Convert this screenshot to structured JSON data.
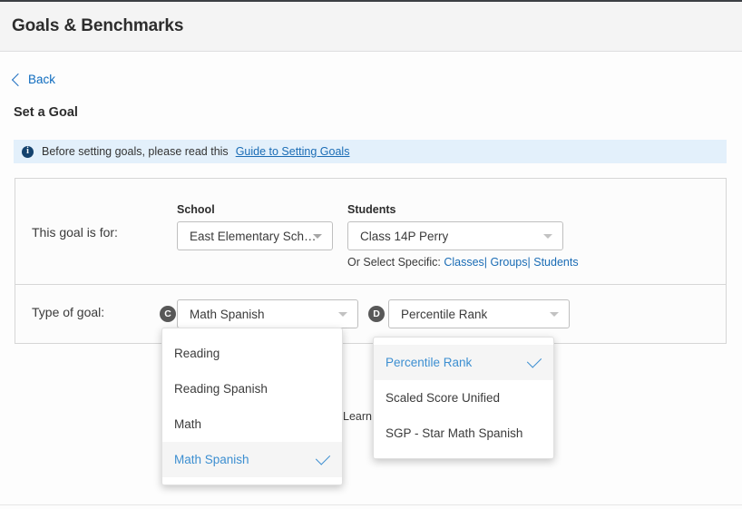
{
  "header": {
    "title": "Goals & Benchmarks"
  },
  "nav": {
    "back_label": "Back",
    "back_icon": "chevron-left-icon"
  },
  "page": {
    "sub_heading": "Set a Goal"
  },
  "info_banner": {
    "icon": "info-circle-icon",
    "text": "Before setting goals, please read this",
    "link_label": "Guide to Setting Goals",
    "background_color": "#e3f0fb",
    "link_color": "#1a6cb5"
  },
  "goal_for_row": {
    "label": "This goal is for:",
    "school": {
      "field_label": "School",
      "value": "East Elementary Sch…",
      "caret_icon": "chevron-down-icon"
    },
    "students": {
      "field_label": "Students",
      "value": "Class 14P Perry",
      "caret_icon": "chevron-down-icon"
    },
    "or_select": {
      "prefix": "Or Select Specific:",
      "links": [
        "Classes",
        "Groups",
        "Students"
      ],
      "separator": "|"
    }
  },
  "goal_type_row": {
    "label": "Type of goal:",
    "badge_c": "C",
    "badge_d": "D",
    "goal_type": {
      "value": "Math Spanish",
      "caret_icon": "chevron-down-icon"
    },
    "metric": {
      "value": "Percentile Rank",
      "caret_icon": "chevron-down-icon"
    },
    "obscured_text": "Learn"
  },
  "goal_type_dropdown": {
    "items": [
      {
        "label": "Reading",
        "selected": false
      },
      {
        "label": "Reading Spanish",
        "selected": false
      },
      {
        "label": "Math",
        "selected": false
      },
      {
        "label": "Math Spanish",
        "selected": true
      }
    ],
    "check_icon": "check-icon"
  },
  "metric_dropdown": {
    "items": [
      {
        "label": "Percentile Rank",
        "selected": true
      },
      {
        "label": "Scaled Score Unified",
        "selected": false
      },
      {
        "label": "SGP - Star Math Spanish",
        "selected": false
      }
    ],
    "check_icon": "check-icon"
  },
  "colors": {
    "accent": "#1a6cb5",
    "selected_text": "#3d8fd1",
    "badge": "#585858",
    "panel_border": "#d6d6d6"
  }
}
